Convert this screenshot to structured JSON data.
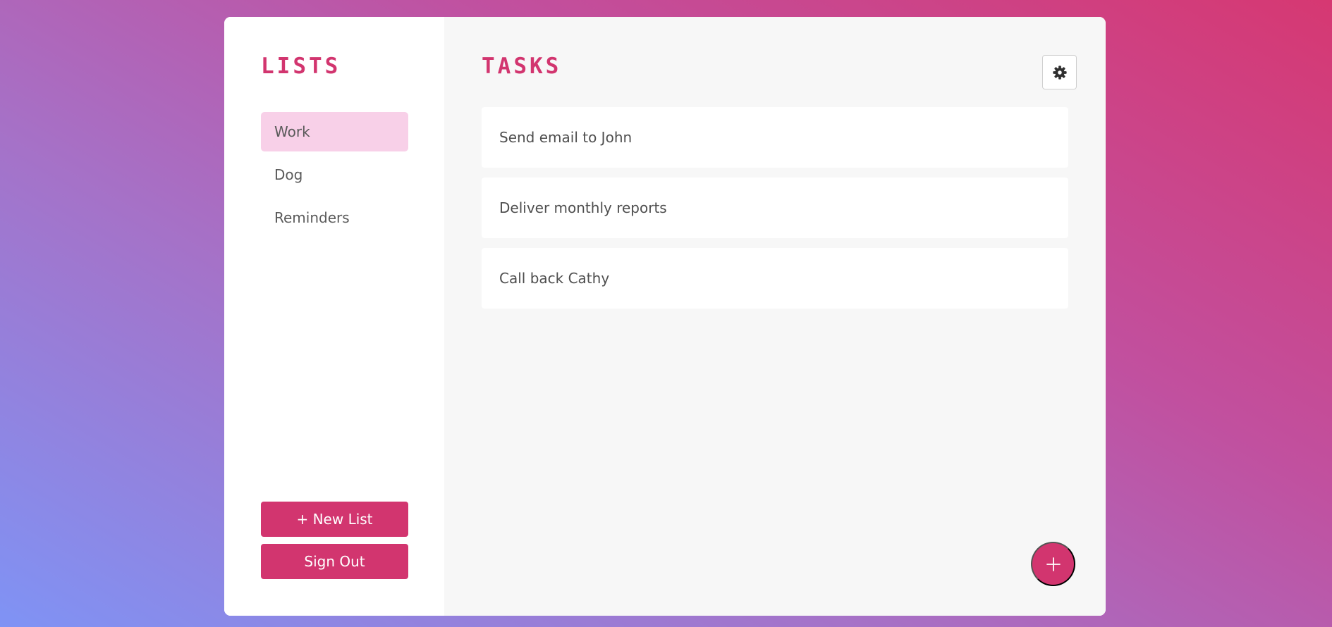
{
  "sidebar": {
    "title": "LISTS",
    "items": [
      {
        "label": "Work",
        "active": true
      },
      {
        "label": "Dog",
        "active": false
      },
      {
        "label": "Reminders",
        "active": false
      }
    ],
    "new_list_label": "+ New List",
    "sign_out_label": "Sign Out"
  },
  "main": {
    "title": "TASKS",
    "settings_icon": "gear-icon",
    "add_icon": "plus-icon",
    "tasks": [
      {
        "label": "Send email to John"
      },
      {
        "label": "Deliver monthly reports"
      },
      {
        "label": "Call back Cathy"
      }
    ]
  },
  "colors": {
    "accent": "#d2356f",
    "active_item_bg": "#f8d0e8",
    "main_bg": "#f7f7f7",
    "text": "#4e4e4e"
  }
}
